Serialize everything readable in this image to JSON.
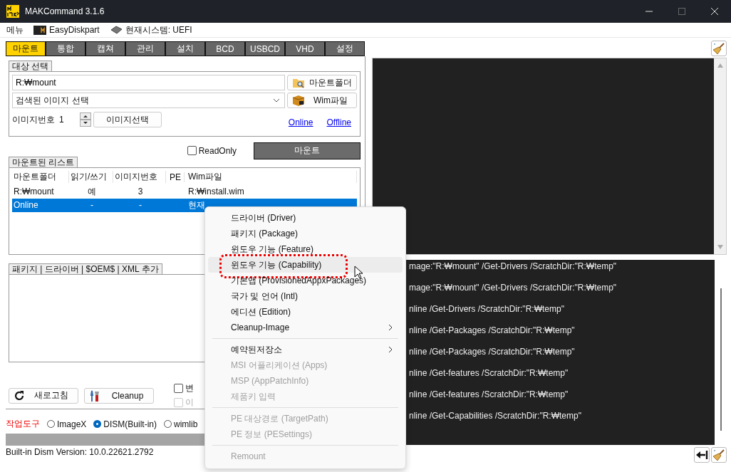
{
  "window": {
    "title": "MAKCommand 3.1.6"
  },
  "menubar": {
    "menu": "메뉴",
    "easydiskpart": "EasyDiskpart",
    "system": "현재시스템: UEFI"
  },
  "tabs": [
    {
      "label": "마운트",
      "selected": true
    },
    {
      "label": "통합",
      "selected": false
    },
    {
      "label": "캡쳐",
      "selected": false
    },
    {
      "label": "관리",
      "selected": false
    },
    {
      "label": "설치",
      "selected": false
    },
    {
      "label": "BCD",
      "selected": false
    },
    {
      "label": "USBCD",
      "selected": false
    },
    {
      "label": "VHD",
      "selected": false
    },
    {
      "label": "설정",
      "selected": false
    }
  ],
  "target": {
    "title": "대상 선택",
    "path": "R:₩mount",
    "mount_folder_button": "마운트폴더",
    "image_select": "검색된 이미지 선택",
    "wim_button": "Wim파일",
    "image_number_label": "이미지번호",
    "image_number": "1",
    "image_select_button": "이미지선택",
    "links": [
      "Online",
      "Offline"
    ]
  },
  "readonly": {
    "label": "ReadOnly",
    "checked": false
  },
  "mount_button": "마운트",
  "mounted_list": {
    "title": "마운트된 리스트",
    "columns": [
      "마운트폴더",
      "읽기/쓰기",
      "이미지번호",
      "PE",
      "Wim파일"
    ],
    "rows": [
      {
        "folder": "R:₩mount",
        "rw": "예",
        "index": "3",
        "wim": "R:₩install.wim",
        "selected": false
      },
      {
        "folder": "Online",
        "rw": "-",
        "index": "-",
        "wim": "현재",
        "selected": true
      }
    ]
  },
  "packages_group": {
    "title": "패키지 | 드라이버 | $OEM$ | XML 추가"
  },
  "refresh_button": "새로고침",
  "cleanup_button": "Cleanup",
  "options": [
    {
      "label": "변",
      "checked": false,
      "disabled": false
    },
    {
      "label": "이",
      "checked": false,
      "disabled": true
    }
  ],
  "tools": {
    "label": "작업도구",
    "choices": [
      {
        "label": "ImageX",
        "selected": false
      },
      {
        "label": "DISM(Built-in)",
        "selected": true
      },
      {
        "label": "wimlib",
        "selected": false
      }
    ]
  },
  "status": "Built-in Dism Version: 10.0.22621.2792",
  "console_lines": [
    "mage:\"R:₩mount\" /Get-Drivers /ScratchDir:\"R:₩temp\"",
    "mage:\"R:₩mount\" /Get-Drivers /ScratchDir:\"R:₩temp\"",
    "nline /Get-Drivers /ScratchDir:\"R:₩temp\"",
    "nline /Get-Packages /ScratchDir:\"R:₩temp\"",
    "nline /Get-Packages /ScratchDir:\"R:₩temp\"",
    "nline /Get-features /ScratchDir:\"R:₩temp\"",
    "nline /Get-features /ScratchDir:\"R:₩temp\"",
    "nline /Get-Capabilities /ScratchDir:\"R:₩temp\""
  ],
  "context_menu": [
    {
      "kind": "item",
      "label": "드라이버 (Driver)",
      "disabled": false,
      "submenu": false,
      "selected": false,
      "annotated": false
    },
    {
      "kind": "item",
      "label": "패키지 (Package)",
      "disabled": false,
      "submenu": false,
      "selected": false,
      "annotated": false
    },
    {
      "kind": "item",
      "label": "윈도우 기능 (Feature)",
      "disabled": false,
      "submenu": false,
      "selected": false,
      "annotated": false
    },
    {
      "kind": "item",
      "label": "윈도우 기능 (Capability)",
      "disabled": false,
      "submenu": false,
      "selected": true,
      "annotated": true
    },
    {
      "kind": "item",
      "label": "기본앱 (ProvisionedAppxPackages)",
      "disabled": false,
      "submenu": false,
      "selected": false,
      "annotated": false
    },
    {
      "kind": "item",
      "label": "국가 및 언어 (Intl)",
      "disabled": false,
      "submenu": false,
      "selected": false,
      "annotated": false
    },
    {
      "kind": "item",
      "label": "에디션 (Edition)",
      "disabled": false,
      "submenu": false,
      "selected": false,
      "annotated": false
    },
    {
      "kind": "item",
      "label": "Cleanup-Image",
      "disabled": false,
      "submenu": true,
      "selected": false,
      "annotated": false
    },
    {
      "kind": "separator"
    },
    {
      "kind": "item",
      "label": "예약된저장소",
      "disabled": false,
      "submenu": true,
      "selected": false,
      "annotated": false
    },
    {
      "kind": "item",
      "label": "MSI 어플리케이션 (Apps)",
      "disabled": true,
      "submenu": false,
      "selected": false,
      "annotated": false
    },
    {
      "kind": "item",
      "label": "MSP (AppPatchInfo)",
      "disabled": true,
      "submenu": false,
      "selected": false,
      "annotated": false
    },
    {
      "kind": "item",
      "label": "제품키 입력",
      "disabled": true,
      "submenu": false,
      "selected": false,
      "annotated": false
    },
    {
      "kind": "separator"
    },
    {
      "kind": "item",
      "label": "PE 대상경로 (TargetPath)",
      "disabled": true,
      "submenu": false,
      "selected": false,
      "annotated": false
    },
    {
      "kind": "item",
      "label": "PE 정보 (PESettings)",
      "disabled": true,
      "submenu": false,
      "selected": false,
      "annotated": false
    },
    {
      "kind": "separator"
    },
    {
      "kind": "item",
      "label": "Remount",
      "disabled": true,
      "submenu": false,
      "selected": false,
      "annotated": false
    }
  ]
}
